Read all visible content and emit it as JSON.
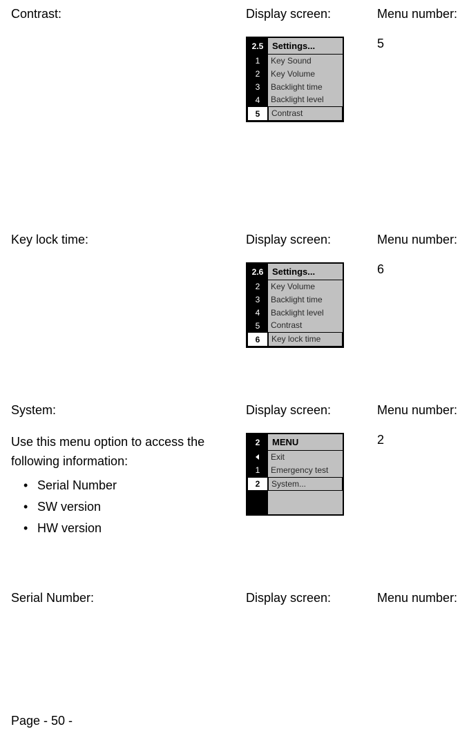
{
  "sections": [
    {
      "left_title": "Contrast:",
      "display_label": "Display screen:",
      "menu_label": "Menu number:",
      "menu_number": "5",
      "description": "",
      "bullets": [],
      "lcd": {
        "header_num": "2.5",
        "header_title": "Settings...",
        "rows": [
          {
            "num": "1",
            "label": "Key Sound",
            "sel": false
          },
          {
            "num": "2",
            "label": "Key Volume",
            "sel": false
          },
          {
            "num": "3",
            "label": "Backlight time",
            "sel": false
          },
          {
            "num": "4",
            "label": "Backlight level",
            "sel": false
          },
          {
            "num": "5",
            "label": "Contrast",
            "sel": true
          }
        ],
        "blank_height": 0
      }
    },
    {
      "left_title": "Key lock time:",
      "display_label": "Display screen:",
      "menu_label": "Menu number:",
      "menu_number": "6",
      "description": "",
      "bullets": [],
      "lcd": {
        "header_num": "2.6",
        "header_title": "Settings...",
        "rows": [
          {
            "num": "2",
            "label": "Key Volume",
            "sel": false
          },
          {
            "num": "3",
            "label": "Backlight time",
            "sel": false
          },
          {
            "num": "4",
            "label": "Backlight level",
            "sel": false
          },
          {
            "num": "5",
            "label": "Contrast",
            "sel": false
          },
          {
            "num": "6",
            "label": "Key lock time",
            "sel": true
          }
        ],
        "blank_height": 0
      }
    },
    {
      "left_title": "System:",
      "display_label": "Display screen:",
      "menu_label": "Menu number:",
      "menu_number": "2",
      "description": "Use this menu option to access the following information:",
      "bullets": [
        "Serial Number",
        "SW version",
        "HW version"
      ],
      "lcd": {
        "header_num": "2",
        "header_title": "MENU",
        "rows": [
          {
            "num": "back",
            "label": "Exit",
            "sel": false
          },
          {
            "num": "1",
            "label": "Emergency test",
            "sel": false
          },
          {
            "num": "2",
            "label": "System...",
            "sel": true
          }
        ],
        "blank_height": 34
      }
    },
    {
      "left_title": "Serial Number:",
      "display_label": "Display screen:",
      "menu_label": "Menu number:",
      "menu_number": "",
      "description": "",
      "bullets": [],
      "lcd": null
    }
  ],
  "footer": "Page - 50 -"
}
